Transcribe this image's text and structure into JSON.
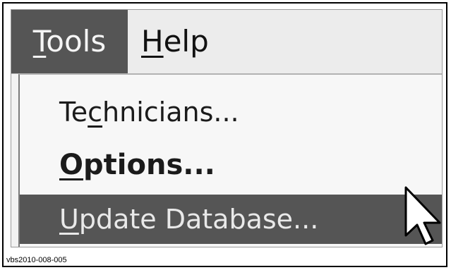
{
  "menubar": {
    "tools": {
      "label_prefix": "",
      "mnemonic": "T",
      "label_rest": "ools"
    },
    "help": {
      "mnemonic": "H",
      "label_rest": "elp"
    }
  },
  "tools_menu": {
    "technicians": {
      "before": "Te",
      "mnemonic": "c",
      "after": "hnicians..."
    },
    "options": {
      "mnemonic": "O",
      "after": "ptions..."
    },
    "update_database": {
      "mnemonic": "U",
      "after": "pdate Database..."
    }
  },
  "caption": "vbs2010-008-005",
  "colors": {
    "highlight": "#555555",
    "menu_bg": "#f7f7f7",
    "menubar_bg": "#ececec"
  },
  "icons": {
    "cursor": "mouse-pointer-arrow-icon"
  }
}
